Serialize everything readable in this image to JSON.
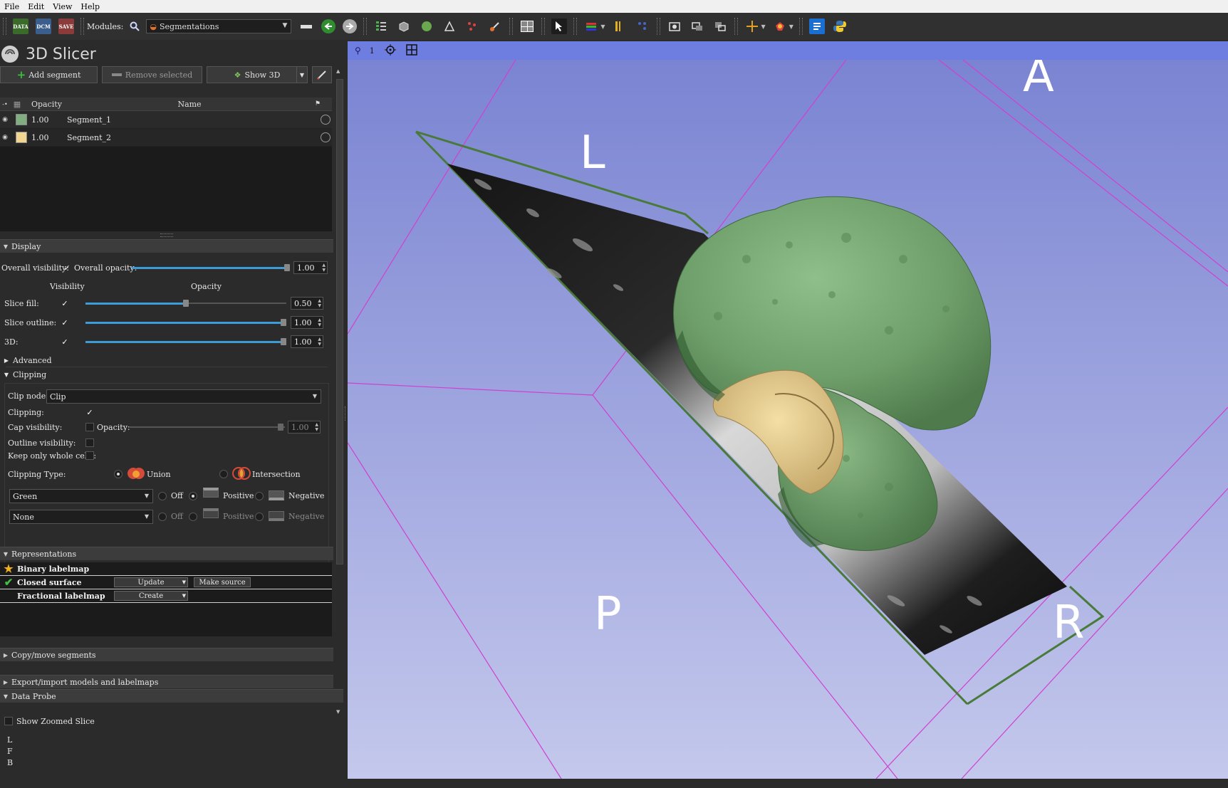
{
  "menubar": [
    "File",
    "Edit",
    "View",
    "Help"
  ],
  "toolbar": {
    "data_label": "DATA",
    "dcm_label": "DCM",
    "save_label": "SAVE",
    "modules_label": "Modules:",
    "module_selected": "Segmentations"
  },
  "app": {
    "title": "3D Slicer"
  },
  "segment_actions": {
    "add": "Add segment",
    "remove": "Remove selected",
    "show3d": "Show 3D"
  },
  "segment_table": {
    "columns": [
      "Opacity",
      "Name"
    ],
    "rows": [
      {
        "opacity": "1.00",
        "name": "Segment_1",
        "color": "#80ae80"
      },
      {
        "opacity": "1.00",
        "name": "Segment_2",
        "color": "#f1d691"
      }
    ]
  },
  "display": {
    "section_title": "Display",
    "overall_visibility_label": "Overall visibility:",
    "overall_opacity_label": "Overall opacity:",
    "overall_opacity_value": "1.00",
    "col_visibility": "Visibility",
    "col_opacity": "Opacity",
    "rows": [
      {
        "label": "Slice fill:",
        "value": "0.50",
        "level": 0.5
      },
      {
        "label": "Slice outline:",
        "value": "1.00",
        "level": 1.0
      },
      {
        "label": "3D:",
        "value": "1.00",
        "level": 1.0
      }
    ],
    "advanced_label": "Advanced"
  },
  "clipping": {
    "section_title": "Clipping",
    "clip_node_label": "Clip node:",
    "clip_node_value": "Clip",
    "clipping_label": "Clipping:",
    "cap_visibility_label": "Cap visibility:",
    "cap_opacity_label": "Opacity:",
    "cap_opacity_value": "1.00",
    "outline_visibility_label": "Outline visibility:",
    "keep_whole_cells_label": "Keep only whole cells:",
    "clipping_type_label": "Clipping Type:",
    "union_label": "Union",
    "intersection_label": "Intersection",
    "slice_rows": [
      {
        "node": "Green",
        "off": "Off",
        "positive": "Positive",
        "negative": "Negative"
      },
      {
        "node": "None",
        "off": "Off",
        "positive": "Positive",
        "negative": "Negative"
      }
    ]
  },
  "representations": {
    "section_title": "Representations",
    "rows": [
      {
        "name": "Binary labelmap",
        "icon": "star-icon"
      },
      {
        "name": "Closed surface",
        "icon": "checkmark-icon",
        "action1": "Update",
        "action2": "Make source"
      },
      {
        "name": "Fractional labelmap",
        "icon": "",
        "action1": "Create"
      }
    ]
  },
  "copy_move": {
    "section_title": "Copy/move segments"
  },
  "export_import": {
    "section_title": "Export/import models and labelmaps"
  },
  "data_probe": {
    "section_title": "Data Probe",
    "show_zoomed_label": "Show Zoomed Slice",
    "coords": [
      "L",
      "F",
      "B"
    ]
  },
  "view3d": {
    "view_number": "1",
    "orientation_labels": {
      "A": "A",
      "L": "L",
      "P": "P",
      "R": "R"
    },
    "background_top": "#7a84d2",
    "background_bottom": "#c4c8ec",
    "box_color": "#d040d0",
    "plane_color": "#4a7a3a"
  }
}
